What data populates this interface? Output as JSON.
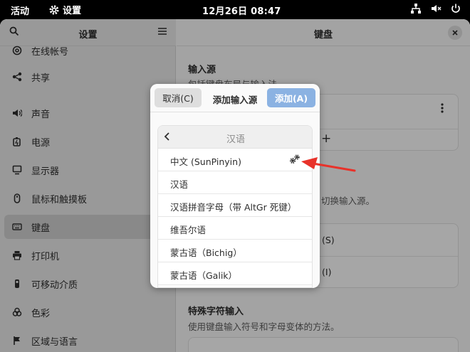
{
  "topbar": {
    "activities": "活动",
    "app_name": "设置",
    "clock": "12月26日  08:47"
  },
  "sidebar": {
    "title": "设置",
    "items": [
      {
        "label": "在线帐号",
        "icon": "at-icon"
      },
      {
        "label": "共享",
        "icon": "share-icon"
      },
      {
        "label": "声音",
        "icon": "speaker-icon"
      },
      {
        "label": "电源",
        "icon": "power-battery-icon"
      },
      {
        "label": "显示器",
        "icon": "display-icon"
      },
      {
        "label": "鼠标和触摸板",
        "icon": "mouse-icon"
      },
      {
        "label": "键盘",
        "icon": "keyboard-icon",
        "active": true
      },
      {
        "label": "打印机",
        "icon": "printer-icon"
      },
      {
        "label": "可移动介质",
        "icon": "removable-media-icon"
      },
      {
        "label": "色彩",
        "icon": "color-icon"
      },
      {
        "label": "区域与语言",
        "icon": "region-icon"
      }
    ]
  },
  "content": {
    "title": "键盘",
    "input_sources": {
      "title": "输入源",
      "desc": "包括键盘布局与输入法",
      "plus": "+"
    },
    "switch_desc_tail": "切换输入源。",
    "row_a_tail": "(S)",
    "row_b_tail": "(I)",
    "special_chars": {
      "title": "特殊字符输入",
      "desc": "使用键盘输入符号和字母变体的方法。"
    }
  },
  "dialog": {
    "cancel_label": "取消(C)",
    "title": "添加输入源",
    "add_label": "添加(A)",
    "back_label": "汉语",
    "languages": [
      {
        "label": "中文 (SunPinyin)",
        "has_settings": true
      },
      {
        "label": "汉语"
      },
      {
        "label": "汉语拼音字母（带 AltGr 死键）"
      },
      {
        "label": "维吾尔语"
      },
      {
        "label": "蒙古语（Bichig）"
      },
      {
        "label": "蒙古语（Galik）"
      }
    ]
  },
  "colors": {
    "accent": "#8bb2e2",
    "arrow": "#e8322a",
    "topbar": "#000000"
  }
}
